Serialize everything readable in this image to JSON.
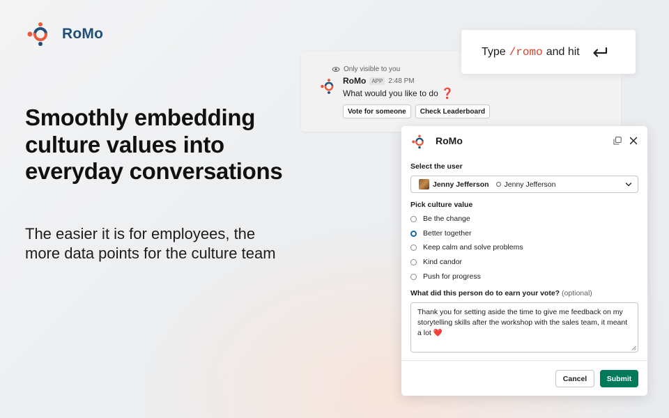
{
  "brand": {
    "name": "RoMo",
    "logo_icon": "romo-logo-icon",
    "primary": "#1f4e79",
    "accent": "#e9593a"
  },
  "hero": {
    "headline": "Smoothly embedding culture values into everyday conversations",
    "subtext": "The easier it is for employees, the more data points for the culture team"
  },
  "hint": {
    "prefix": "Type",
    "command": "/romo",
    "suffix": "and hit",
    "icon": "enter-return-icon"
  },
  "message": {
    "visibility": "Only visible to you",
    "visibility_icon": "eye-icon",
    "sender": "RoMo",
    "badge": "APP",
    "time": "2:48 PM",
    "text": "What would you like to do",
    "emoji": "❓",
    "actions": [
      "Vote for someone",
      "Check Leaderboard"
    ]
  },
  "modal": {
    "title": "RoMo",
    "user_section": {
      "label": "Select the user",
      "selected_name": "Jenny Jefferson",
      "selected_display": "Jenny Jefferson"
    },
    "culture_section": {
      "label": "Pick culture value",
      "options": [
        "Be the change",
        "Better together",
        "Keep calm and solve problems",
        "Kind candor",
        "Push for progress"
      ],
      "selected": "Better together"
    },
    "reason_section": {
      "label": "What did this person do to earn your vote?",
      "optional": "(optional)",
      "value": "Thank you for setting aside the time to give me feedback on my storytelling skills after the workshop with the sales team, it meant a lot",
      "emoji": "❤️"
    },
    "cancel_label": "Cancel",
    "submit_label": "Submit",
    "submit_color": "#007a5a"
  }
}
